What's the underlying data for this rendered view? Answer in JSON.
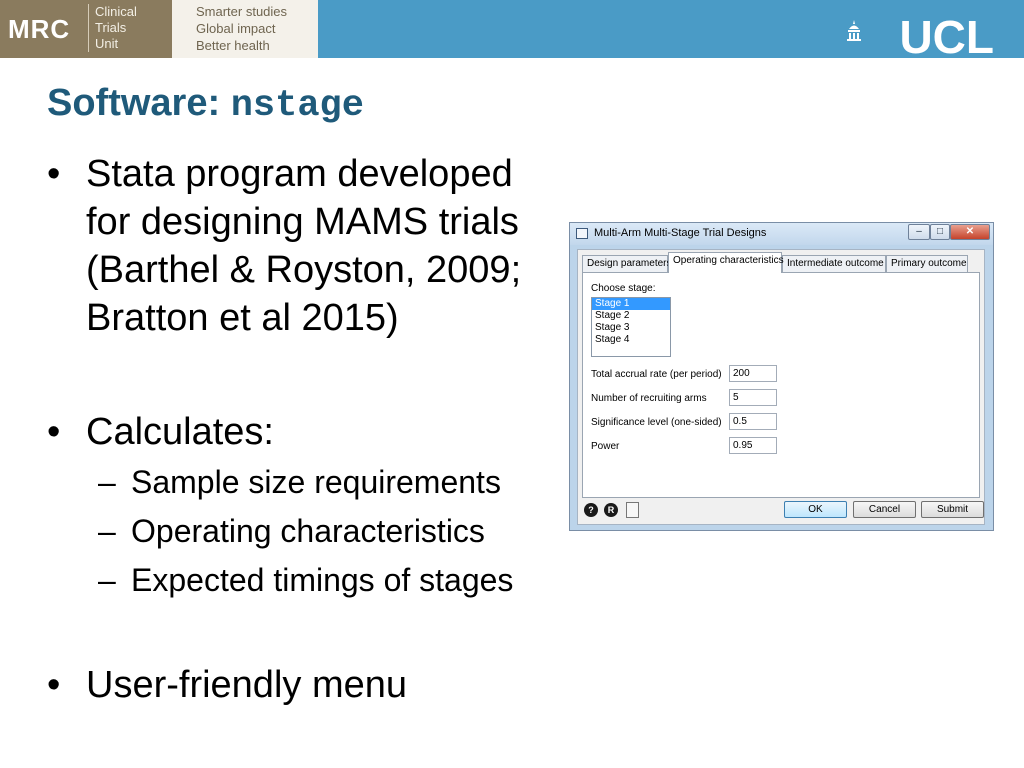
{
  "header": {
    "mrc_logo": "MRC",
    "mrc_unit_lines": [
      "Clinical",
      "Trials",
      "Unit"
    ],
    "tagline_lines": [
      "Smarter studies",
      "Global impact",
      "Better health"
    ],
    "ucl_logo": "UCL",
    "banner_color": "#4a9bc6",
    "mrc_color": "#8a7b5e"
  },
  "slide": {
    "title_prefix": "Software:",
    "title_code": "nstage",
    "title_color": "#1f5a7a",
    "bullets": [
      {
        "lines": [
          "Stata program developed",
          "for designing MAMS trials",
          "(Barthel & Royston, 2009;",
          "Bratton et al 2015)"
        ]
      },
      {
        "lines": [
          "Calculates:"
        ],
        "sub": [
          "Sample size requirements",
          "Operating characteristics",
          "Expected timings of stages"
        ]
      },
      {
        "lines": [
          "User-friendly menu"
        ]
      }
    ],
    "bullet_glyph": "•",
    "dash_glyph": "–"
  },
  "dialog": {
    "title": "Multi-Arm Multi-Stage Trial Designs",
    "tabs": [
      "Design parameters",
      "Operating characteristics",
      "Intermediate outcome",
      "Primary outcome"
    ],
    "active_tab": "Operating characteristics",
    "choose_stage_label": "Choose stage:",
    "stages": [
      "Stage 1",
      "Stage 2",
      "Stage 3",
      "Stage 4"
    ],
    "selected_stage": "Stage 1",
    "fields": [
      {
        "label": "Total accrual rate (per period)",
        "value": "200"
      },
      {
        "label": "Number of recruiting arms",
        "value": "5"
      },
      {
        "label": "Significance level (one-sided)",
        "value": "0.5"
      },
      {
        "label": "Power",
        "value": "0.95"
      }
    ],
    "footer_icons": [
      "help-icon",
      "reset-icon",
      "copy-icon"
    ],
    "help_glyph": "?",
    "reset_glyph": "R",
    "buttons": {
      "ok": "OK",
      "cancel": "Cancel",
      "submit": "Submit"
    },
    "window_controls": {
      "minimize": "–",
      "maximize": "□",
      "close": "✕"
    }
  }
}
